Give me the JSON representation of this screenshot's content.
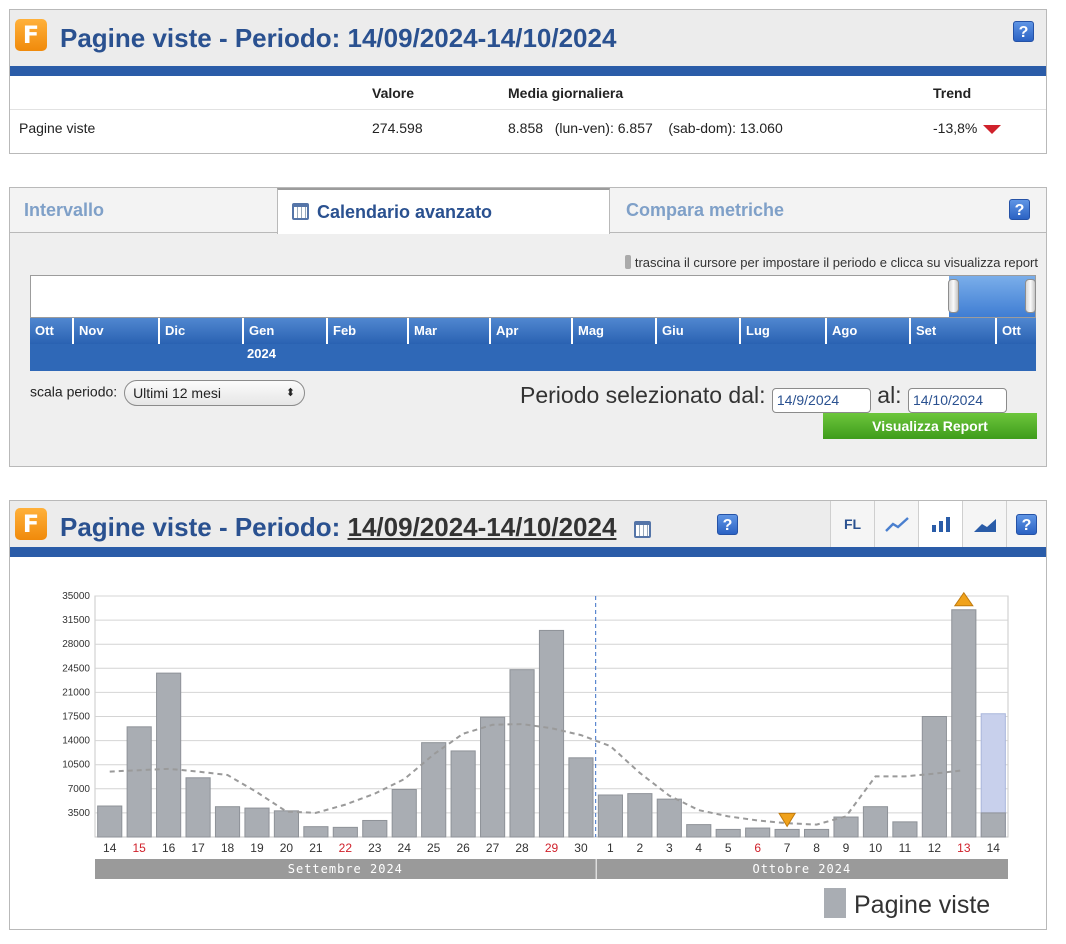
{
  "summary": {
    "title_prefix": "Pagine viste - Periodo: ",
    "title_dates": "14/09/2024-14/10/2024",
    "logo_letter": "F",
    "help": "?",
    "headers": {
      "metric": "",
      "valore": "Valore",
      "media": "Media giornaliera",
      "trend": "Trend"
    },
    "row": {
      "metric": "Pagine viste",
      "valore": "274.598",
      "media": "8.858",
      "lunven": "(lun-ven): 6.857",
      "sabdom": "(sab-dom): 13.060",
      "trend": "-13,8%"
    }
  },
  "calendar": {
    "tabs": [
      {
        "label": "Intervallo"
      },
      {
        "label": "Calendario avanzato"
      },
      {
        "label": "Compara metriche"
      }
    ],
    "hint": "trascina il cursore per impostare il periodo e clicca su visualizza report",
    "months": [
      "Ott",
      "Nov",
      "Dic",
      "Gen",
      "Feb",
      "Mar",
      "Apr",
      "Mag",
      "Giu",
      "Lug",
      "Ago",
      "Set",
      "Ott"
    ],
    "year_label": "2024",
    "scala_label": "scala periodo:",
    "scala_value": "Ultimi 12 mesi",
    "periodo_label": "Periodo selezionato dal:",
    "from": "14/9/2024",
    "al_label": "al:",
    "to": "14/10/2024",
    "button": "Visualizza Report"
  },
  "chart_panel": {
    "title_prefix": "Pagine viste - Periodo: ",
    "title_dates": "14/09/2024-14/10/2024",
    "fl_label": "FL",
    "legend": "Pagine viste",
    "colors": {
      "bar": "#a9adb3",
      "bar_current": "#c8d0ec",
      "trend_line": "#9a9a9a",
      "weekend_label": "#d0212b",
      "marker": "#f0a21b"
    }
  },
  "chart_data": {
    "type": "bar",
    "ylim": [
      0,
      35000
    ],
    "yticks": [
      3500,
      7000,
      10500,
      14000,
      17500,
      21000,
      24500,
      28000,
      31500,
      35000
    ],
    "categories": [
      "14",
      "15",
      "16",
      "17",
      "18",
      "19",
      "20",
      "21",
      "22",
      "23",
      "24",
      "25",
      "26",
      "27",
      "28",
      "29",
      "30",
      "1",
      "2",
      "3",
      "4",
      "5",
      "6",
      "7",
      "8",
      "9",
      "10",
      "11",
      "12",
      "13",
      "14"
    ],
    "weekend_categories_index": [
      1,
      8,
      15,
      22,
      29
    ],
    "series": [
      {
        "name": "Pagine viste",
        "values": [
          4500,
          16000,
          23800,
          8600,
          4400,
          4200,
          3800,
          1500,
          1400,
          2400,
          6900,
          13700,
          12500,
          17400,
          24300,
          30000,
          11500,
          6100,
          6300,
          5500,
          1800,
          1100,
          1300,
          1100,
          1100,
          2900,
          4400,
          2200,
          17500,
          33000,
          3500
        ]
      }
    ],
    "current_day_total": 17900,
    "trend": [
      9500,
      9700,
      9900,
      9500,
      9000,
      6500,
      3700,
      3500,
      4700,
      6300,
      8400,
      12000,
      15000,
      16300,
      16400,
      15800,
      14800,
      13200,
      9300,
      6000,
      3900,
      3000,
      2400,
      2000,
      1800,
      3000,
      8800,
      8800,
      9200,
      9700
    ],
    "month_labels": [
      {
        "label": "Settembre 2024"
      },
      {
        "label": "Ottobre 2024"
      }
    ],
    "markers": [
      {
        "index": 23,
        "type": "min"
      },
      {
        "index": 29,
        "type": "max"
      }
    ]
  }
}
